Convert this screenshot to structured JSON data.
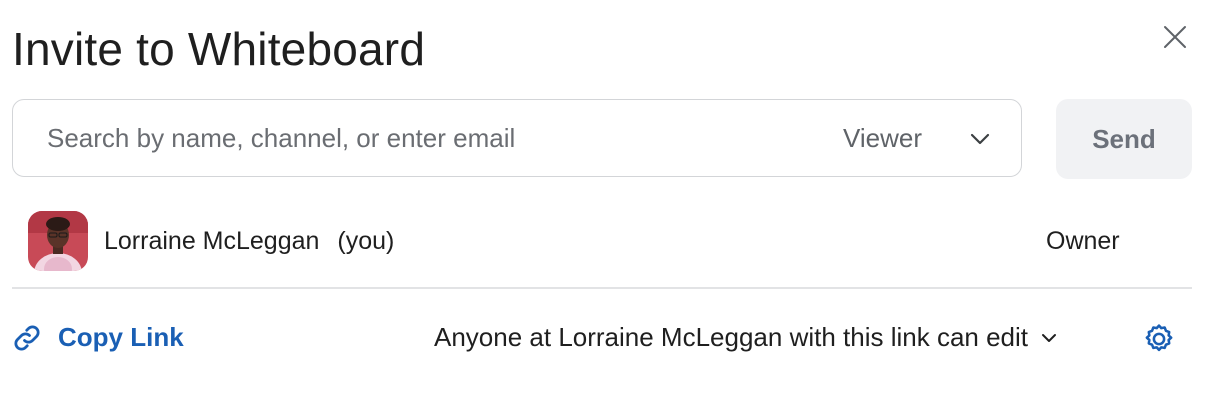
{
  "dialog": {
    "title": "Invite to Whiteboard",
    "close_icon": "close-icon"
  },
  "invite": {
    "search_placeholder": "Search by name, channel, or enter email",
    "search_value": "",
    "role": "Viewer",
    "role_icon": "chevron-down-icon",
    "send_label": "Send"
  },
  "members": [
    {
      "name": "Lorraine McLeggan",
      "you_label": "(you)",
      "role": "Owner",
      "avatar": "user-photo"
    }
  ],
  "link": {
    "copy_label": "Copy Link",
    "copy_icon": "link-icon",
    "permission": "Anyone at Lorraine McLeggan with this link can edit",
    "permission_icon": "chevron-down-icon",
    "settings_icon": "gear-icon"
  },
  "colors": {
    "link_blue": "#1a5fb4",
    "send_bg": "#f1f2f4",
    "send_text": "#6c717a",
    "border": "#d3d5d8"
  }
}
